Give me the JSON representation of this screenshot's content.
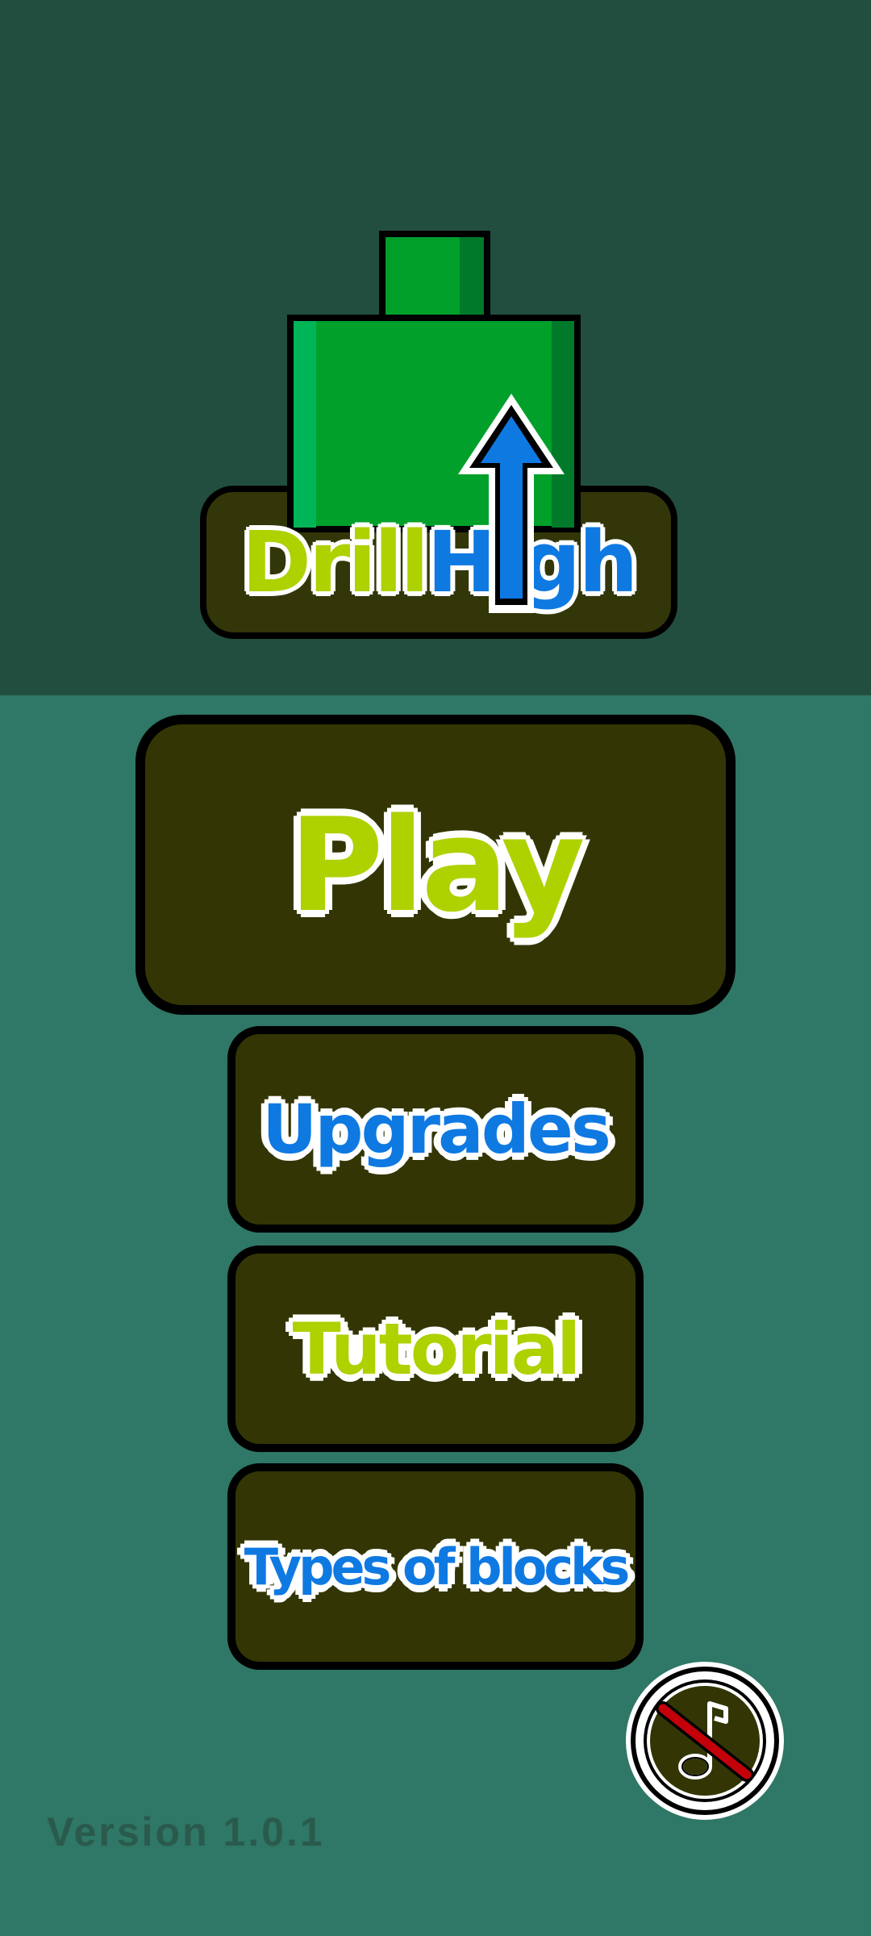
{
  "logo": {
    "word_one": "Drill",
    "word_two": "High",
    "icon": "drill-icon",
    "arrow_icon": "up-arrow-icon"
  },
  "menu": {
    "play_label": "Play",
    "upgrades_label": "Upgrades",
    "tutorial_label": "Tutorial",
    "types_label": "Types of blocks"
  },
  "music": {
    "icon": "music-muted-icon",
    "state": "muted"
  },
  "footer": {
    "version": "Version 1.0.1"
  },
  "colors": {
    "top_background": "#224e40",
    "bottom_background": "#2f7766",
    "button_fill": "#333604",
    "lime": "#aed100",
    "blue": "#0f79e2",
    "drill_green": "#00a02a"
  }
}
